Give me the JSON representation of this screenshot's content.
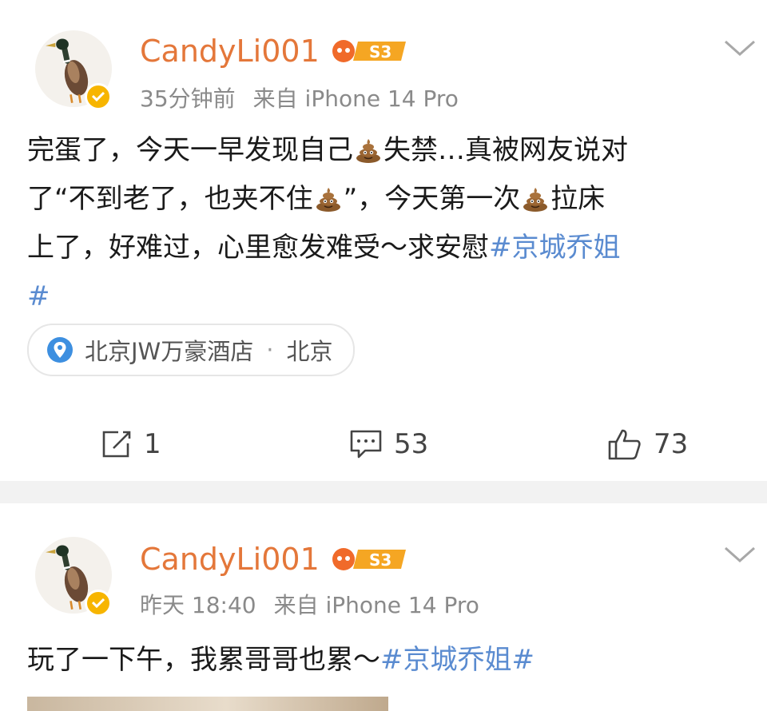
{
  "posts": [
    {
      "username": "CandyLi001",
      "level": "S3",
      "time": "35分钟前",
      "source": "来自 iPhone 14 Pro",
      "text": {
        "l1a": "完蛋了，今天一早发现自己",
        "l1b": "失禁…真被网友说对",
        "l2a": "了“不到老了，也夹不住",
        "l2b": "”，今天第一次",
        "l2c": "拉床",
        "l3": "上了，好难过，心里愈发难受～求安慰",
        "tag_part1": "#京城乔姐",
        "tag_part2": "#"
      },
      "location": {
        "name": "北京JW万豪酒店",
        "dot": "·",
        "city": "北京"
      },
      "actions": {
        "repost": "1",
        "comments": "53",
        "likes": "73"
      }
    },
    {
      "username": "CandyLi001",
      "level": "S3",
      "time": "昨天 18:40",
      "source": "来自 iPhone 14 Pro",
      "text": {
        "main": "玩了一下午，我累哥哥也累～",
        "tag": "#京城乔姐#"
      }
    }
  ],
  "icons": [
    "duck-avatar",
    "verified-badge-icon",
    "level-badge-icon",
    "chevron-down-icon",
    "poop-emoji",
    "location-pin-icon",
    "repost-icon",
    "comment-icon",
    "like-icon"
  ],
  "colors": {
    "username": "#e4773a",
    "hashtag": "#5a8bd0",
    "verified": "#f7b500",
    "meta": "#8a8a8a",
    "separator": "#f2f2f2"
  }
}
